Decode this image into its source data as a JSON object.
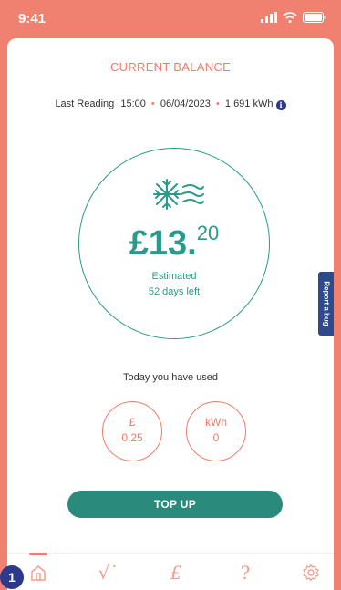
{
  "status_bar": {
    "time": "9:41"
  },
  "balance": {
    "title": "CURRENT BALANCE",
    "reading_label": "Last Reading",
    "reading_time": "15:00",
    "reading_date": "06/04/2023",
    "reading_value": "1,691 kWh",
    "amount_main": "£13.",
    "amount_pence": "20",
    "estimated_label": "Estimated",
    "days_left": "52 days left"
  },
  "usage": {
    "label": "Today you have used",
    "cost_unit": "£",
    "cost_value": "0.25",
    "energy_unit": "kWh",
    "energy_value": "0"
  },
  "actions": {
    "top_up": "TOP UP",
    "report_bug": "Report a bug"
  },
  "nav": {
    "items": [
      "home-icon",
      "usage-icon",
      "pound-icon",
      "help-icon",
      "settings-icon"
    ],
    "active": "home-icon"
  },
  "badge": "1",
  "colors": {
    "accent": "#ef7c69",
    "teal": "#2a9a8a",
    "navy": "#2d3a8c"
  }
}
